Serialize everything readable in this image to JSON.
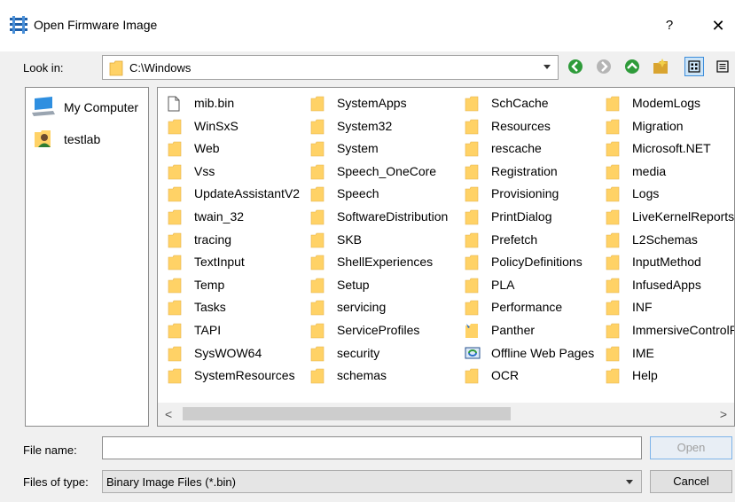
{
  "window": {
    "title": "Open Firmware Image",
    "help_glyph": "?",
    "close_glyph": "✕"
  },
  "lookin": {
    "label": "Look in:",
    "value": "C:\\Windows"
  },
  "toolbar": {
    "icons": [
      "back-icon",
      "forward-icon",
      "up-icon",
      "new-folder-icon",
      "list-view-icon",
      "detail-view-icon"
    ]
  },
  "sidebar": {
    "items": [
      {
        "label": "My Computer",
        "icon": "computer-icon"
      },
      {
        "label": "testlab",
        "icon": "user-folder-icon"
      }
    ]
  },
  "files": {
    "columns": [
      [
        "mib.bin",
        "WinSxS",
        "Web",
        "Vss",
        "UpdateAssistantV2",
        "twain_32",
        "tracing",
        "TextInput",
        "Temp",
        "Tasks",
        "TAPI",
        "SysWOW64",
        "SystemResources"
      ],
      [
        "SystemApps",
        "System32",
        "System",
        "Speech_OneCore",
        "Speech",
        "SoftwareDistribution",
        "SKB",
        "ShellExperiences",
        "Setup",
        "servicing",
        "ServiceProfiles",
        "security",
        "schemas"
      ],
      [
        "SchCache",
        "Resources",
        "rescache",
        "Registration",
        "Provisioning",
        "PrintDialog",
        "Prefetch",
        "PolicyDefinitions",
        "PLA",
        "Performance",
        "Panther",
        "Offline Web Pages",
        "OCR"
      ],
      [
        "ModemLogs",
        "Migration",
        "Microsoft.NET",
        "media",
        "Logs",
        "LiveKernelReports",
        "L2Schemas",
        "InputMethod",
        "InfusedApps",
        "INF",
        "ImmersiveControlPanel",
        "IME",
        "Help"
      ]
    ],
    "special_icons": {
      "mib.bin": "file-icon",
      "Panther": "special-folder-icon",
      "Offline Web Pages": "offline-folder-icon"
    }
  },
  "scroll": {
    "left": "<",
    "right": ">"
  },
  "filename": {
    "label": "File name:",
    "value": "",
    "open_label": "Open"
  },
  "filetype": {
    "label": "Files of type:",
    "value": "Binary Image Files (*.bin)",
    "cancel_label": "Cancel"
  },
  "colors": {
    "folder": "#ffd266",
    "accent_green": "#2e9b3a",
    "border_focus": "#7eb4ea"
  }
}
